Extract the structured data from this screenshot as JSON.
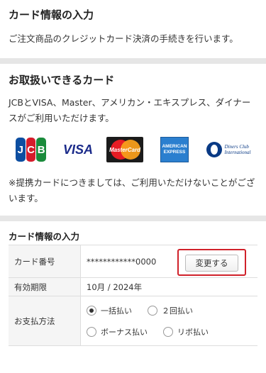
{
  "card_info": {
    "title": "カード情報の入力",
    "description": "ご注文商品のクレジットカード決済の手続きを行います。"
  },
  "accepted_cards": {
    "title": "お取扱いできるカード",
    "description": "JCBとVISA、Master、アメリカン・エキスプレス、ダイナースがご利用いただけます。",
    "logos": {
      "jcb": [
        "J",
        "C",
        "B"
      ],
      "visa": "VISA",
      "mastercard": "MasterCard",
      "amex": [
        "AMERICAN",
        "EXPRESS"
      ],
      "diners": [
        "Diners Club",
        "International"
      ]
    },
    "note": "※提携カードにつきましては、ご利用いただけないことがございます。"
  },
  "form": {
    "title": "カード情報の入力",
    "card_number_label": "カード番号",
    "card_number_value": "************0000",
    "change_button": "変更する",
    "expiry_label": "有効期限",
    "expiry_value": "10月 / 2024年",
    "payment_label": "お支払方法",
    "payment_options": [
      {
        "label": "一括払い",
        "selected": true
      },
      {
        "label": "２回払い",
        "selected": false
      },
      {
        "label": "ボーナス払い",
        "selected": false
      },
      {
        "label": "リボ払い",
        "selected": false
      }
    ]
  },
  "colors": {
    "highlight": "#d0212a",
    "separator": "#e6e6e6"
  }
}
